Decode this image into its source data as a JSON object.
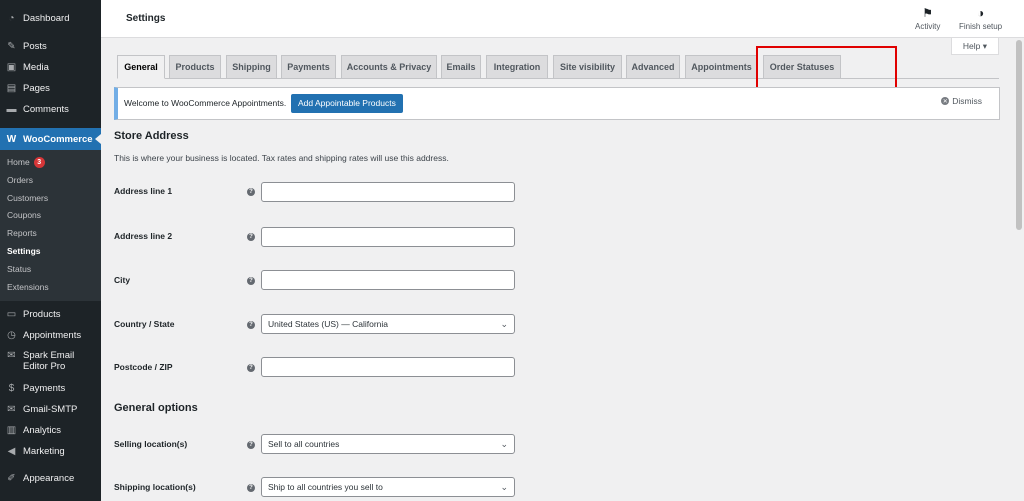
{
  "sidebar": {
    "dashboard": "Dashboard",
    "posts": "Posts",
    "media": "Media",
    "pages": "Pages",
    "comments": "Comments",
    "woocommerce": "WooCommerce",
    "submenu": {
      "home": "Home",
      "home_badge": "3",
      "orders": "Orders",
      "customers": "Customers",
      "coupons": "Coupons",
      "reports": "Reports",
      "settings": "Settings",
      "status": "Status",
      "extensions": "Extensions"
    },
    "products": "Products",
    "appointments": "Appointments",
    "spark_line1": "Spark Email",
    "spark_line2": "Editor Pro",
    "payments": "Payments",
    "gmail_smtp": "Gmail-SMTP",
    "analytics": "Analytics",
    "marketing": "Marketing",
    "appearance": "Appearance"
  },
  "header": {
    "title": "Settings",
    "activity": "Activity",
    "finish_setup": "Finish setup",
    "help": "Help"
  },
  "tabs": [
    "General",
    "Products",
    "Shipping",
    "Payments",
    "Accounts & Privacy",
    "Emails",
    "Integration",
    "Site visibility",
    "Advanced",
    "Appointments",
    "Order Statuses"
  ],
  "notice": {
    "message": "Welcome to WooCommerce Appointments.",
    "button": "Add Appointable Products",
    "dismiss": "Dismiss"
  },
  "store_address": {
    "title": "Store Address",
    "description": "This is where your business is located. Tax rates and shipping rates will use this address.",
    "address1_label": "Address line 1",
    "address2_label": "Address line 2",
    "city_label": "City",
    "country_label": "Country / State",
    "country_value": "United States (US) — California",
    "postcode_label": "Postcode / ZIP"
  },
  "general_options": {
    "title": "General options",
    "selling_label": "Selling location(s)",
    "selling_value": "Sell to all countries",
    "shipping_label": "Shipping location(s)",
    "shipping_value": "Ship to all countries you sell to"
  }
}
